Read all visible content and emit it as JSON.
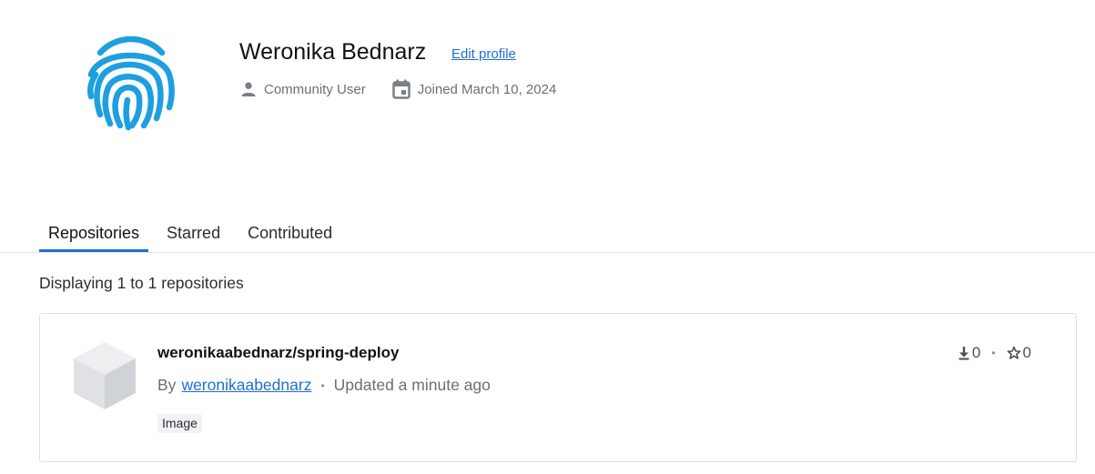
{
  "profile": {
    "name": "Weronika Bednarz",
    "edit_label": "Edit profile",
    "role": "Community User",
    "joined": "Joined March 10, 2024",
    "avatar_icon": "fingerprint-icon"
  },
  "tabs": [
    {
      "label": "Repositories",
      "active": true
    },
    {
      "label": "Starred",
      "active": false
    },
    {
      "label": "Contributed",
      "active": false
    }
  ],
  "listing": {
    "count_text": "Displaying 1 to 1 repositories"
  },
  "repos": [
    {
      "name": "weronikaabednarz/spring-deploy",
      "by_label": "By",
      "author": "weronikaabednarz",
      "separator": "•",
      "updated": "Updated a minute ago",
      "badge": "Image",
      "downloads": "0",
      "stars": "0",
      "icon": "cube-icon"
    }
  ],
  "colors": {
    "accent": "#1f6fd1",
    "fingerprint": "#1d9fe0",
    "muted_text": "#6b6f76"
  }
}
